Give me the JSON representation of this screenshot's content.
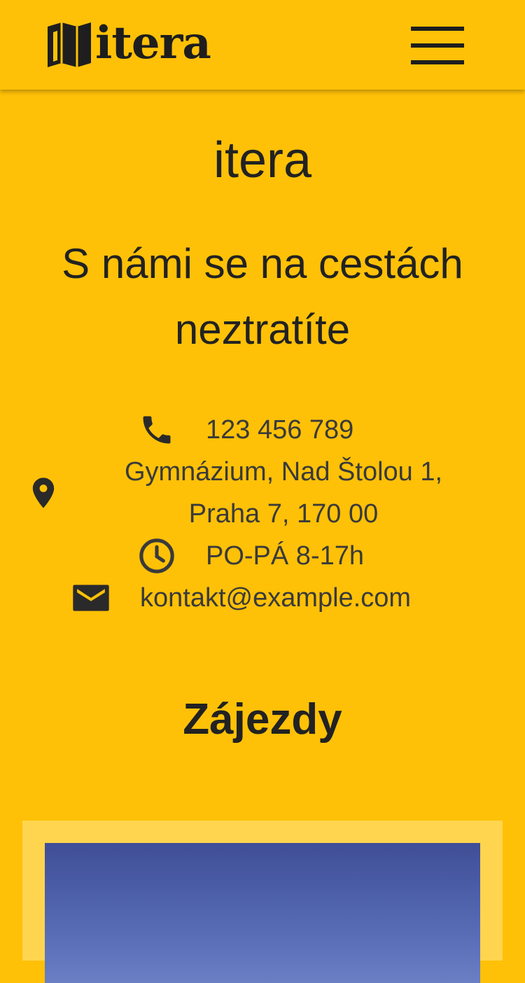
{
  "header": {
    "logo_text": "itera",
    "menu_icon": "hamburger-menu-icon"
  },
  "hero": {
    "title": "itera",
    "tagline": "S námi se na cestách neztratíte"
  },
  "contact": {
    "phone": "123 456 789",
    "address_line1": "Gymnázium, Nad Štolou 1,",
    "address_line2": "Praha 7, 170 00",
    "hours": "PO-PÁ 8-17h",
    "email": "kontakt@example.com",
    "icons": [
      "phone-icon",
      "location-pin-icon",
      "clock-icon",
      "mail-icon"
    ]
  },
  "trips": {
    "title": "Zájezdy"
  },
  "colors": {
    "background": "#FFC107",
    "card": "#FFD54F",
    "text": "#222222",
    "icon": "#3a3a3a"
  }
}
